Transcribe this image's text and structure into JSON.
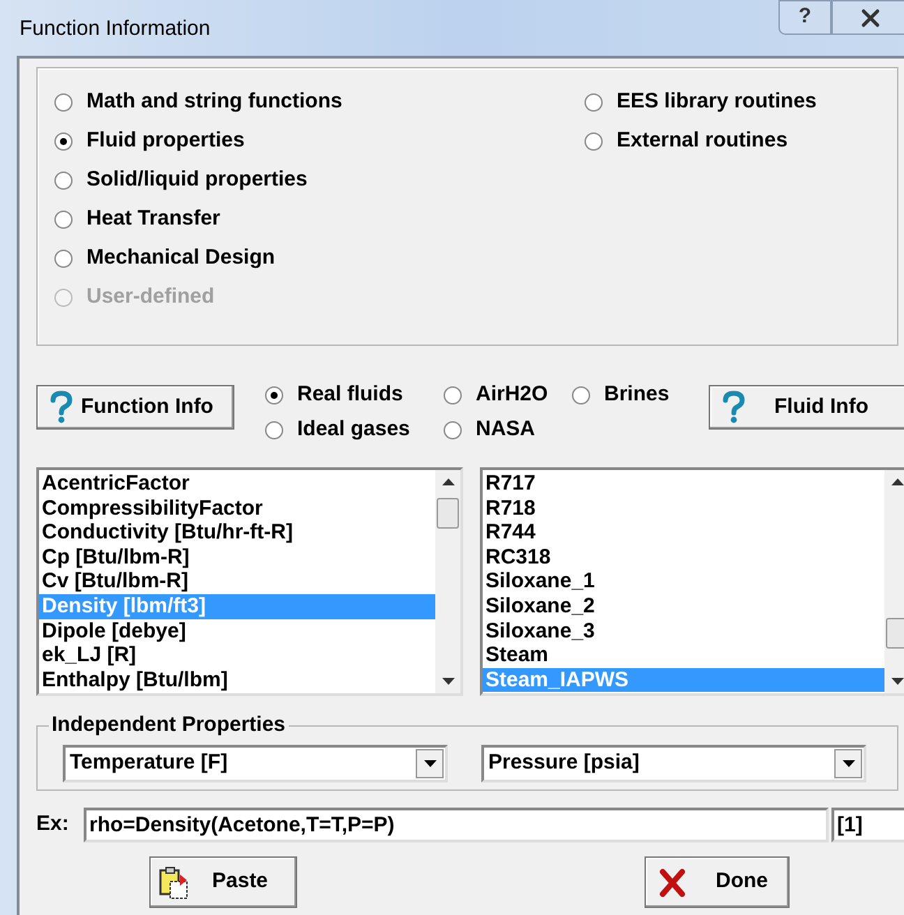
{
  "window": {
    "title": "Function Information",
    "help_button": "?"
  },
  "categories_left": [
    {
      "label": "Math and string functions",
      "selected": false,
      "disabled": false
    },
    {
      "label": "Fluid properties",
      "selected": true,
      "disabled": false
    },
    {
      "label": "Solid/liquid properties",
      "selected": false,
      "disabled": false
    },
    {
      "label": "Heat Transfer",
      "selected": false,
      "disabled": false
    },
    {
      "label": "Mechanical Design",
      "selected": false,
      "disabled": false
    },
    {
      "label": "User-defined",
      "selected": false,
      "disabled": true
    }
  ],
  "categories_right": [
    {
      "label": "EES library routines",
      "selected": false,
      "disabled": false
    },
    {
      "label": "External routines",
      "selected": false,
      "disabled": false
    }
  ],
  "function_info_button": "Function Info",
  "fluid_types": [
    {
      "label": "Real fluids",
      "selected": true
    },
    {
      "label": "AirH2O",
      "selected": false
    },
    {
      "label": "Brines",
      "selected": false
    },
    {
      "label": "Ideal gases",
      "selected": false
    },
    {
      "label": "NASA",
      "selected": false
    }
  ],
  "fluid_info_button": "Fluid Info",
  "functions": [
    {
      "label": "AcentricFactor",
      "selected": false
    },
    {
      "label": "CompressibilityFactor",
      "selected": false
    },
    {
      "label": "Conductivity [Btu/hr-ft-R]",
      "selected": false
    },
    {
      "label": "Cp [Btu/lbm-R]",
      "selected": false
    },
    {
      "label": "Cv [Btu/lbm-R]",
      "selected": false
    },
    {
      "label": "Density [lbm/ft3]",
      "selected": true
    },
    {
      "label": "Dipole [debye]",
      "selected": false
    },
    {
      "label": "ek_LJ [R]",
      "selected": false
    },
    {
      "label": "Enthalpy [Btu/lbm]",
      "selected": false
    }
  ],
  "fluids": [
    {
      "label": "R717",
      "selected": false
    },
    {
      "label": "R718",
      "selected": false
    },
    {
      "label": "R744",
      "selected": false
    },
    {
      "label": "RC318",
      "selected": false
    },
    {
      "label": "Siloxane_1",
      "selected": false
    },
    {
      "label": "Siloxane_2",
      "selected": false
    },
    {
      "label": "Siloxane_3",
      "selected": false
    },
    {
      "label": "Steam",
      "selected": false
    },
    {
      "label": "Steam_IAPWS",
      "selected": true
    }
  ],
  "independent_properties": {
    "title": "Independent Properties",
    "fields": [
      {
        "value": "Temperature [F]"
      },
      {
        "value": "Pressure [psia]"
      }
    ]
  },
  "example": {
    "label": "Ex:",
    "value": "rho=Density(Acetone,T=T,P=P)",
    "index": "[1]"
  },
  "paste_button": "Paste",
  "done_button": "Done"
}
